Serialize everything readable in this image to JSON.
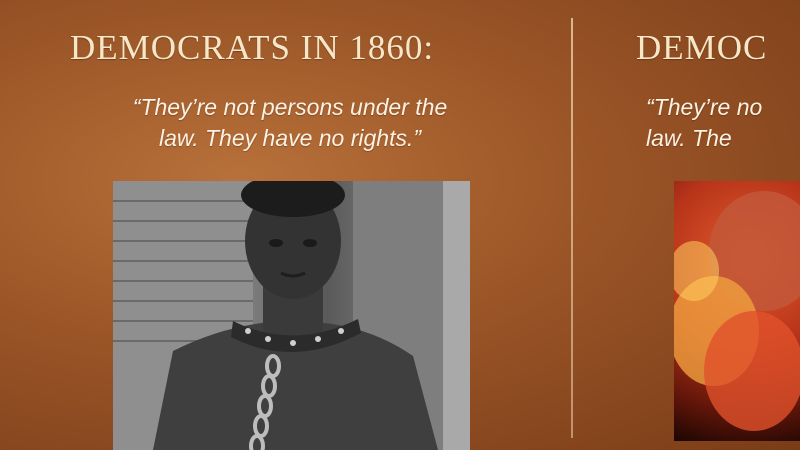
{
  "left_panel": {
    "heading": "DEMOCRATS IN 1860:",
    "quote": "“They’re not persons under the\nlaw. They have no rights.”",
    "photo_icon": "chained-man-photo"
  },
  "right_panel": {
    "heading": "DEMOC",
    "quote": "“They’re no\nlaw. The",
    "photo_icon": "fetus-photo"
  },
  "colors": {
    "background": "#9a5527",
    "heading": "#f6e7c8",
    "quote": "#fbf2e4",
    "divider": "#e9c9a4"
  }
}
